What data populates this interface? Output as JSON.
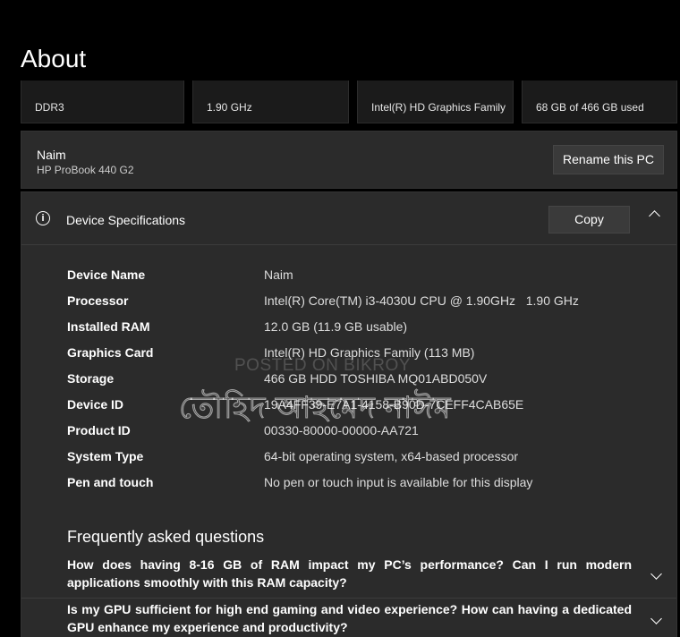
{
  "title": "About",
  "summary_cards": [
    "DDR3",
    "1.90 GHz",
    "Intel(R) HD Graphics Family",
    "68 GB of 466 GB used"
  ],
  "pc": {
    "name": "Naim",
    "model": "HP ProBook 440 G2",
    "rename_label": "Rename this PC"
  },
  "specs": {
    "title": "Device Specifications",
    "copy_label": "Copy",
    "rows": [
      {
        "label": "Device Name",
        "value": "Naim"
      },
      {
        "label": "Processor",
        "value": "Intel(R) Core(TM) i3-4030U CPU @ 1.90GHz   1.90 GHz"
      },
      {
        "label": "Installed RAM",
        "value": "12.0 GB (11.9 GB usable)"
      },
      {
        "label": "Graphics Card",
        "value": "Intel(R) HD Graphics Family (113 MB)"
      },
      {
        "label": "Storage",
        "value": "466 GB HDD TOSHIBA MQ01ABD050V"
      },
      {
        "label": "Device ID",
        "value": "19A4FF39-E7A1-4158-B90D-7CEFF4CAB65E"
      },
      {
        "label": "Product ID",
        "value": "00330-80000-00000-AA721"
      },
      {
        "label": "System Type",
        "value": "64-bit operating system, x64-based processor"
      },
      {
        "label": "Pen and touch",
        "value": "No pen or touch input is available for this display"
      }
    ]
  },
  "faq": {
    "title": "Frequently asked questions",
    "items": [
      "How does having 8-16 GB of RAM impact my PC’s performance? Can I run modern applications smoothly with this RAM capacity?",
      "Is my GPU sufficient for high end gaming and video experience? How can having a dedicated GPU enhance my experience and productivity?"
    ]
  },
  "watermark": {
    "english": "POSTED ON BIKROY",
    "bengali": "তৌহিদ আহমেদ নাঈম"
  }
}
